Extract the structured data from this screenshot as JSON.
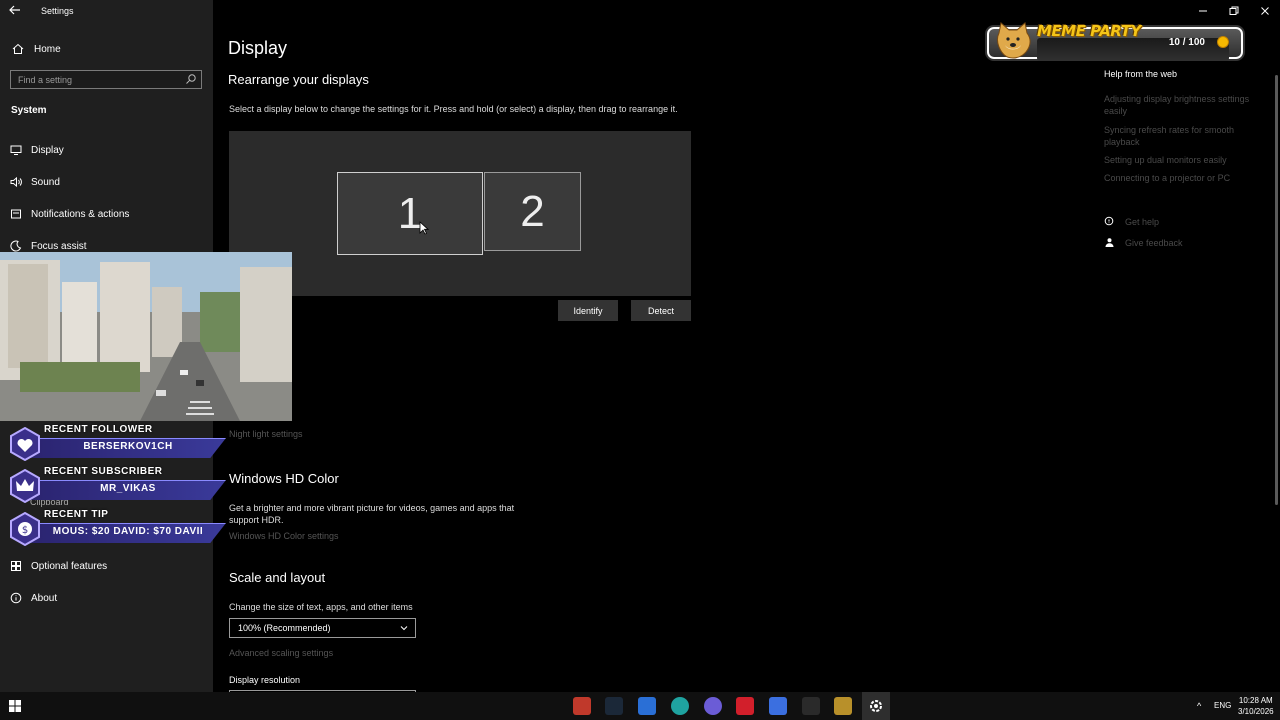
{
  "window": {
    "title": "Settings",
    "controls": [
      "minimize",
      "restore",
      "close"
    ]
  },
  "sidebar": {
    "home_label": "Home",
    "search_placeholder": "Find a setting",
    "section": "System",
    "items": [
      {
        "label": "Display",
        "icon": "monitor-icon",
        "active": true
      },
      {
        "label": "Sound",
        "icon": "speaker-icon"
      },
      {
        "label": "Notifications & actions",
        "icon": "notification-icon"
      },
      {
        "label": "Focus assist",
        "icon": "moon-icon"
      },
      {
        "label": "Optional features",
        "icon": "optional-features-icon"
      },
      {
        "label": "About",
        "icon": "info-icon"
      }
    ],
    "partial_items": [
      "Clipboard"
    ]
  },
  "main": {
    "title": "Display",
    "rearrange_heading": "Rearrange your displays",
    "rearrange_desc": "Select a display below to change the settings for it. Press and hold (or select) a display, then drag to rearrange it.",
    "monitors": [
      "1",
      "2"
    ],
    "identify_label": "Identify",
    "detect_label": "Detect",
    "night_light_link": "Night light settings",
    "hdr_heading": "Windows HD Color",
    "hdr_desc": "Get a brighter and more vibrant picture for videos, games and apps that support HDR.",
    "hdr_link": "Windows HD Color settings",
    "scale_heading": "Scale and layout",
    "scale_label": "Change the size of text, apps, and other items",
    "scale_value": "100% (Recommended)",
    "advanced_scaling_link": "Advanced scaling settings",
    "resolution_label": "Display resolution"
  },
  "help": {
    "title": "Help from the web",
    "links": [
      "Adjusting display brightness settings easily",
      "Syncing refresh rates for smooth playback",
      "Setting up dual monitors easily",
      "Connecting to a projector or PC"
    ],
    "get_help": "Get help",
    "give_feedback": "Give feedback"
  },
  "overlay": {
    "meme_title": "MEME PARTY",
    "meme_count": "10 / 100",
    "alerts": [
      {
        "label": "RECENT FOLLOWER",
        "value": "BERSERKOV1CH",
        "icon": "heart-icon"
      },
      {
        "label": "RECENT SUBSCRIBER",
        "value": "MR_VIKAS",
        "icon": "crown-icon"
      },
      {
        "label": "RECENT TIP",
        "value": "MOUS: $20   DAVID: $70   DAVII",
        "icon": "coin-icon"
      }
    ]
  },
  "taskbar": {
    "language": "ENG",
    "time": "10:28 AM",
    "date": "3/10/2026",
    "apps": [
      "app-red-icon",
      "steam-icon",
      "app-blue-icon",
      "edge-icon",
      "discord-icon",
      "app-red2-icon",
      "app-blue2-icon",
      "app-dark-icon",
      "app-gold-icon",
      "settings-icon"
    ]
  },
  "colors": {
    "sidebar_bg": "#1f1f1f",
    "main_bg": "#000000",
    "arrange_bg": "#2b2b2b",
    "monitor_bg": "#3a3a3a",
    "button_bg": "#333333"
  }
}
